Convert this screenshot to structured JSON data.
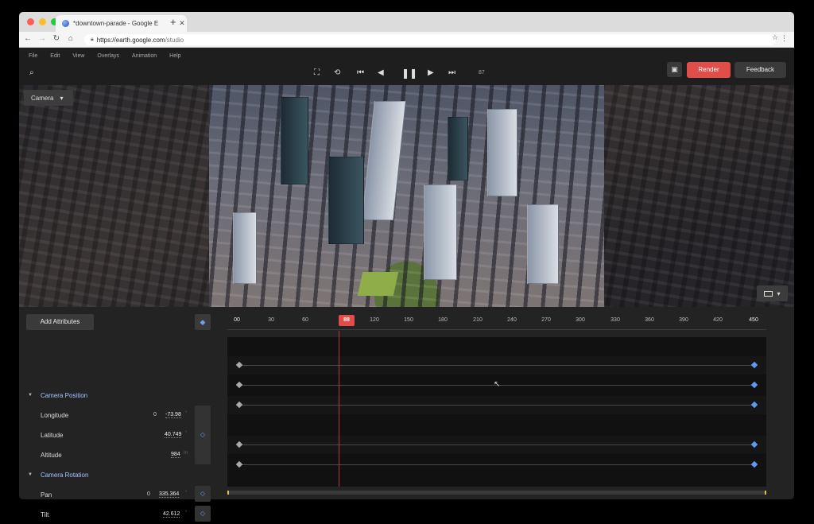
{
  "browser": {
    "tab_title": "*downtown-parade - Google E",
    "url_host": "https://earth.google.com",
    "url_path": "/studio"
  },
  "menu": [
    "File",
    "Edit",
    "View",
    "Overlays",
    "Animation",
    "Help"
  ],
  "toolbar": {
    "frame": "87",
    "render_label": "Render",
    "feedback_label": "Feedback"
  },
  "viewport": {
    "camera_label": "Camera"
  },
  "timeline": {
    "add_attributes_label": "Add Attributes",
    "ticks": [
      "00",
      "30",
      "60",
      "88",
      "120",
      "150",
      "180",
      "210",
      "240",
      "270",
      "300",
      "330",
      "360",
      "390",
      "420",
      "450"
    ],
    "playhead": "88",
    "sections": [
      {
        "title": "Camera Position",
        "props": [
          {
            "label": "Longitude",
            "zero": "0",
            "value": "-73.98",
            "unit": "°"
          },
          {
            "label": "Latitude",
            "zero": "",
            "value": "40.749",
            "unit": "°"
          },
          {
            "label": "Altitude",
            "zero": "",
            "value": "984",
            "unit": "m"
          }
        ]
      },
      {
        "title": "Camera Rotation",
        "props": [
          {
            "label": "Pan",
            "zero": "0",
            "value": "335.364",
            "unit": "°"
          },
          {
            "label": "Tilt",
            "zero": "",
            "value": "42.612",
            "unit": "°"
          }
        ]
      }
    ]
  }
}
